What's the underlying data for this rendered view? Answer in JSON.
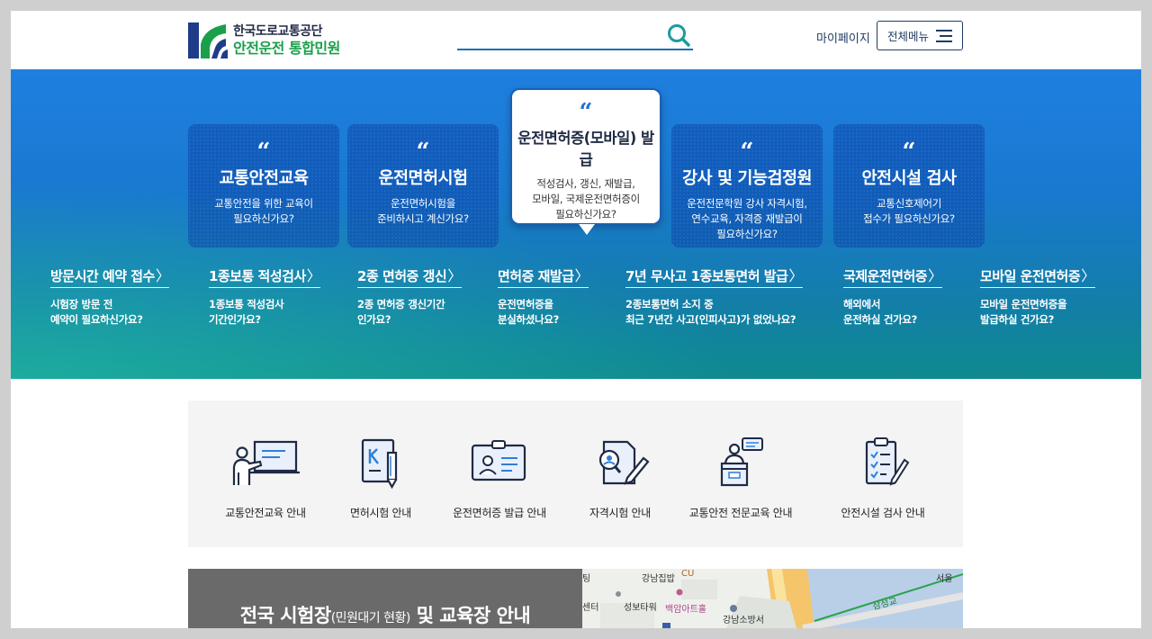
{
  "header": {
    "org_name": "한국도로교통공단",
    "service_name": "안전운전 통합민원",
    "search_placeholder": "",
    "mypage_label": "마이페이지",
    "allmenu_label": "전체메뉴"
  },
  "hero": {
    "cards": [
      {
        "title": "교통안전교육",
        "desc_1": "교통안전을 위한 교육이",
        "desc_2": "필요하신가요?",
        "desc_3": ""
      },
      {
        "title": "운전면허시험",
        "desc_1": "운전면허시험을",
        "desc_2": "준비하시고 계신가요?",
        "desc_3": ""
      },
      {
        "title": "운전면허증(모바일) 발급",
        "desc_1": "적성검사, 갱신, 재발급,",
        "desc_2": "모바일, 국제운전면허증이",
        "desc_3": "필요하신가요?"
      },
      {
        "title": "강사 및 기능검정원",
        "desc_1": "운전전문학원 강사 자격시험,",
        "desc_2": "연수교육, 자격증 재발급이",
        "desc_3": "필요하신가요?"
      },
      {
        "title": "안전시설 검사",
        "desc_1": "교통신호제어기",
        "desc_2": "접수가 필요하신가요?",
        "desc_3": ""
      }
    ],
    "quote_mark": "“",
    "arrow": "〉",
    "links": [
      {
        "title": "방문시간 예약 접수",
        "desc_1": "시험장 방문 전",
        "desc_2": "예약이 필요하신가요?"
      },
      {
        "title": "1종보통 적성검사",
        "desc_1": "1종보통 적성검사",
        "desc_2": "기간인가요?"
      },
      {
        "title": "2종 면허증 갱신",
        "desc_1": "2종 면허증 갱신기간",
        "desc_2": "인가요?"
      },
      {
        "title": "면허증 재발급",
        "desc_1": "운전면허증을",
        "desc_2": "분실하셨나요?"
      },
      {
        "title": "7년 무사고 1종보통면허 발급",
        "desc_1": "2종보통면허 소지 중",
        "desc_2": "최근 7년간 사고(인피사고)가 없었나요?"
      },
      {
        "title": "국제운전면허증",
        "desc_1": "해외에서",
        "desc_2": "운전하실 건가요?"
      },
      {
        "title": "모바일 운전면허증",
        "desc_1": "모바일 운전면허증을",
        "desc_2": "발급하실 건가요?"
      }
    ]
  },
  "guide": {
    "items": [
      {
        "label": "교통안전교육 안내",
        "icon": "teacher-board-icon"
      },
      {
        "label": "면허시험 안내",
        "icon": "exam-document-pen-icon"
      },
      {
        "label": "운전면허증 발급 안내",
        "icon": "license-card-icon"
      },
      {
        "label": "자격시험 안내",
        "icon": "qualification-search-icon"
      },
      {
        "label": "교통안전 전문교육 안내",
        "icon": "lecturer-podium-icon"
      },
      {
        "label": "안전시설 검사 안내",
        "icon": "checklist-clipboard-icon"
      }
    ]
  },
  "centers": {
    "title_main": "전국 시험장",
    "title_sub": "(민원대기 현황)",
    "title_end": "및 교육장 안내"
  },
  "map": {
    "labels": [
      "강남집밥",
      "CU",
      "서울",
      "성보타워",
      "백암아트홀",
      "강남소방서",
      "삼성교",
      "센터",
      "팅"
    ]
  },
  "colors": {
    "brand_green": "#1aa04a",
    "brand_navy": "#1f2a44",
    "hero_blue": "#1f7fe0",
    "hero_teal": "#0f8a8f"
  }
}
